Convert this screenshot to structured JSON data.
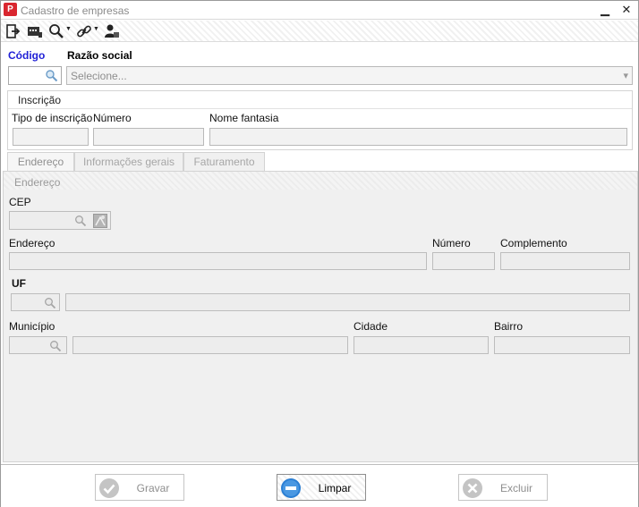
{
  "window": {
    "title": "Cadastro de empresas",
    "minimize_glyph": "▁",
    "close_glyph": "✕",
    "app_icon_glyph": "P"
  },
  "toolbar": {
    "items": [
      {
        "name": "exit-icon"
      },
      {
        "name": "card-reader-icon"
      },
      {
        "name": "search-icon",
        "dropdown": true
      },
      {
        "name": "link-icon",
        "dropdown": true
      },
      {
        "name": "user-card-icon"
      }
    ],
    "caret_glyph": "▼"
  },
  "header": {
    "codigo_label": "Código",
    "codigo_value": "",
    "razao_label": "Razão social",
    "razao_placeholder": "Selecione...",
    "dropdown_glyph": "▾"
  },
  "inscricao": {
    "title": "Inscrição",
    "tipo_label": "Tipo de inscrição",
    "numero_label": "Número",
    "nome_fantasia_label": "Nome fantasia"
  },
  "tabs": [
    {
      "label": "Endereço",
      "active": true
    },
    {
      "label": "Informações gerais",
      "active": false
    },
    {
      "label": "Faturamento",
      "active": false
    }
  ],
  "endereco_panel": {
    "section_title": "Endereço",
    "cep_label": "CEP",
    "endereco_label": "Endereço",
    "numero_label": "Número",
    "complemento_label": "Complemento",
    "uf_label": "UF",
    "municipio_label": "Município",
    "cidade_label": "Cidade",
    "bairro_label": "Bairro"
  },
  "footer": {
    "gravar_label": "Gravar",
    "limpar_label": "Limpar",
    "excluir_label": "Excluir"
  },
  "colors": {
    "accent_blue": "#1f1fd6",
    "app_red": "#d9262f",
    "clear_button_blue": "#2b7fd4"
  }
}
